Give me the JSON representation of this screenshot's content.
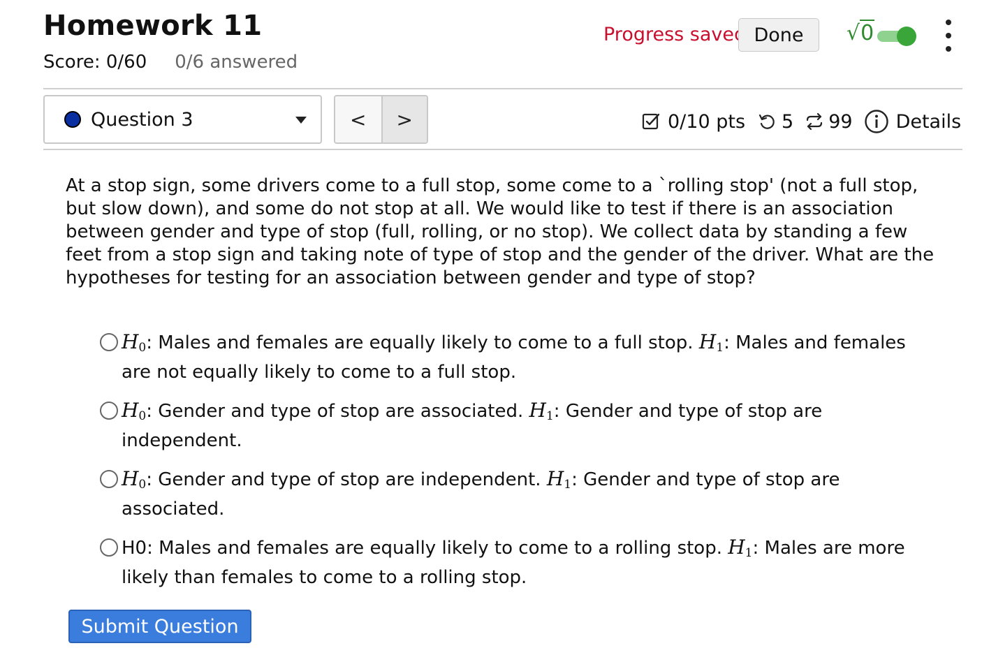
{
  "header": {
    "title": "Homework 11",
    "score": "Score: 0/60",
    "answered": "0/6 answered",
    "progress_saved": "Progress saved",
    "done_label": "Done",
    "sqrt_symbol": "√",
    "sqrt_value": "0",
    "toggle_on": true,
    "accent_color": "#3aa63a",
    "progress_color": "#c8102e"
  },
  "question_nav": {
    "selected_question": "Question 3",
    "status_dot_color": "#0a2fa0",
    "prev_label": "<",
    "next_label": ">"
  },
  "meta": {
    "points": "0/10 pts",
    "attempts": "5",
    "versions": "99",
    "details_label": "Details",
    "icons": [
      "checkbox-icon",
      "retry-icon",
      "repeat-icon",
      "info-icon"
    ]
  },
  "question": {
    "text": "At a stop sign, some drivers come to a full stop, some come to a `rolling stop' (not a full stop, but slow down), and some do not stop at all. We would like to test if there is an association between gender and type of stop (full, rolling, or no stop). We collect data by standing a few feet from a stop sign and taking note of type of stop and the gender of the driver. What are the hypotheses for testing for an association between gender and type of stop?"
  },
  "options": [
    {
      "h0_sym": "H",
      "h0_sub": "0",
      "h0_text": ": Males and females are equally likely to come to a full stop. ",
      "h1_sym": "H",
      "h1_sub": "1",
      "h1_text": ": Males and females are not equally likely to come to a full stop."
    },
    {
      "h0_sym": "H",
      "h0_sub": "0",
      "h0_text": ": Gender and type of stop are associated. ",
      "h1_sym": "H",
      "h1_sub": "1",
      "h1_text": ": Gender and type of stop are independent."
    },
    {
      "h0_sym": "H",
      "h0_sub": "0",
      "h0_text": ": Gender and type of stop are independent. ",
      "h1_sym": "H",
      "h1_sub": "1",
      "h1_text": ": Gender and type of stop are associated."
    },
    {
      "h0_plain": "H0: Males and females are equally likely to come to a rolling stop. ",
      "h1_sym": "H",
      "h1_sub": "1",
      "h1_text": ": Males are more likely than females to come to a rolling stop."
    }
  ],
  "submit_label": "Submit Question",
  "submit_color": "#3b7ddd"
}
